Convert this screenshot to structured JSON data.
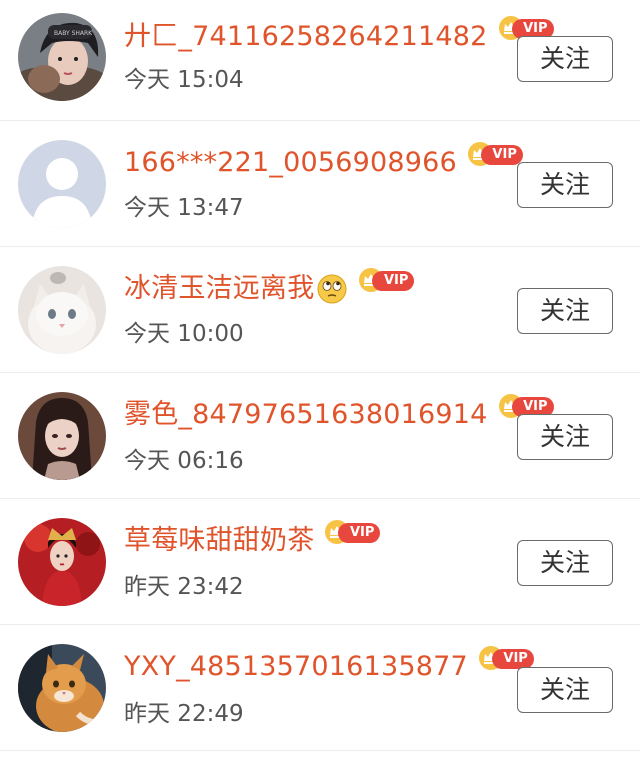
{
  "follow_label": "关注",
  "vip_label": "VIP",
  "colors": {
    "name": "#e0542c",
    "vip_badge": "#e8473e",
    "time": "#555555",
    "separator": "#ececec"
  },
  "users": [
    {
      "name": "廾匚_74116258264211482",
      "time": "今天 15:04",
      "avatar": "girl-with-cap",
      "emoji": ""
    },
    {
      "name": "166***221_0056908966",
      "time": "今天 13:47",
      "avatar": "default-person",
      "emoji": ""
    },
    {
      "name": "冰清玉洁远离我",
      "time": "今天 10:00",
      "avatar": "white-cat",
      "emoji": "eye-roll-emoji"
    },
    {
      "name": "雾色_84797651638016914",
      "time": "今天 06:16",
      "avatar": "dark-hair-girl",
      "emoji": ""
    },
    {
      "name": "草莓味甜甜奶茶",
      "time": "昨天 23:42",
      "avatar": "red-costume-girl",
      "emoji": ""
    },
    {
      "name": "YXY_4851357016135877",
      "time": "昨天 22:49",
      "avatar": "orange-cat",
      "emoji": ""
    }
  ]
}
